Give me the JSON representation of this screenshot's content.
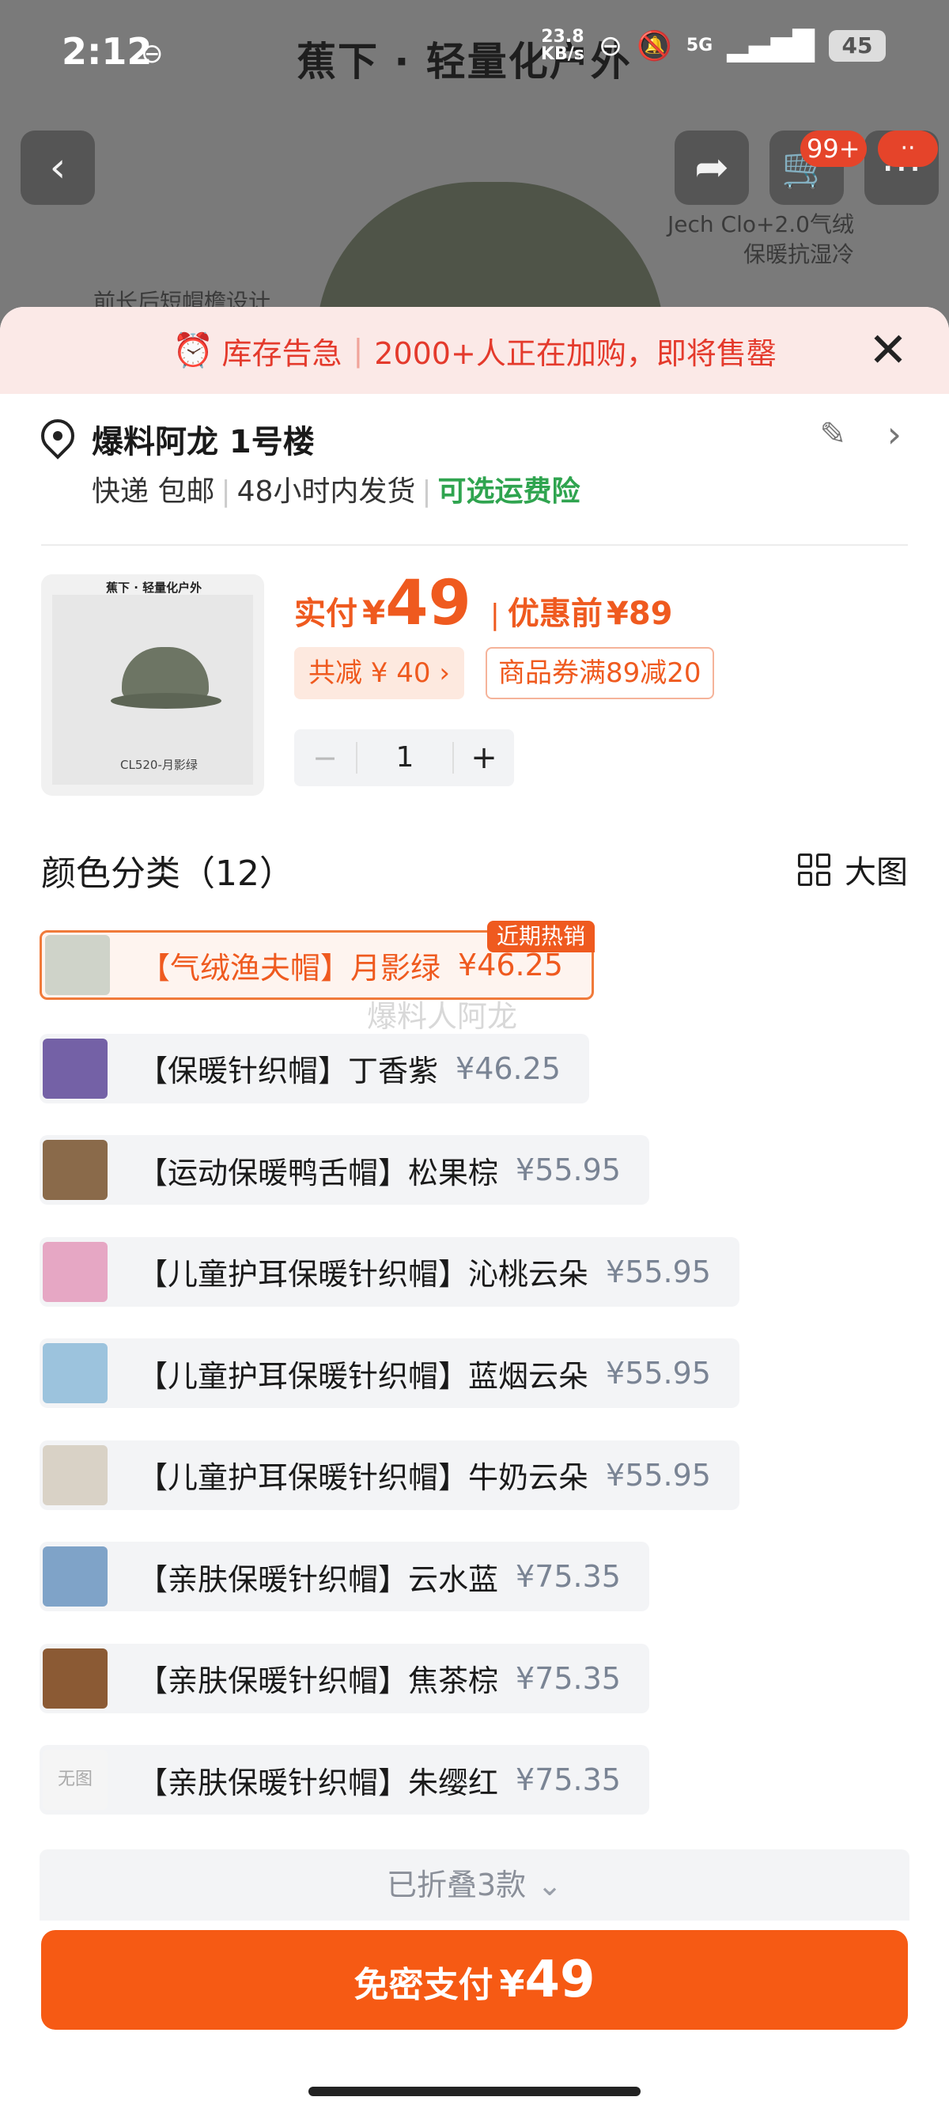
{
  "status_bar": {
    "time": "2:12",
    "net_speed_value": "23.8",
    "net_speed_unit": "KB/s",
    "signal": "5G",
    "battery": "45"
  },
  "background": {
    "brand": "蕉下 · 轻量化户外",
    "note_line1": "Jech Clo+2.0气绒",
    "note_line2": "保暖抗湿冷",
    "note_left": "前长后短帽檐设计"
  },
  "nav": {
    "cart_badge": "99+",
    "more_badge": "··"
  },
  "alert": {
    "text1": "库存告急",
    "text2": "2000+人正在加购，即将售罄"
  },
  "address": {
    "name": "爆料阿龙 1号楼",
    "shipping_method": "快递 包邮",
    "ship_time": "48小时内发货",
    "insurance": "可选运费险"
  },
  "product": {
    "thumb_brand": "蕉下 · 轻量化户外",
    "thumb_caption": "CL520-月影绿",
    "price_label": "实付",
    "currency": "¥",
    "price": "49",
    "before_label": "优惠前",
    "before_price": "¥89",
    "discount": "共减 ¥ 40 ›",
    "coupon": "商品券满89减20",
    "quantity": "1",
    "minus": "−",
    "plus": "+"
  },
  "category": {
    "title": "颜色分类（12）",
    "view_toggle": "大图",
    "hot_tag": "近期热销",
    "watermark": "爆料人阿龙",
    "variants": [
      {
        "name": "【气绒渔夫帽】月影绿",
        "price": "¥46.25",
        "selected": true
      },
      {
        "name": "【保暖针织帽】丁香紫",
        "price": "¥46.25"
      },
      {
        "name": "【运动保暖鸭舌帽】松果棕",
        "price": "¥55.95"
      },
      {
        "name": "【儿童护耳保暖针织帽】沁桃云朵",
        "price": "¥55.95"
      },
      {
        "name": "【儿童护耳保暖针织帽】蓝烟云朵",
        "price": "¥55.95"
      },
      {
        "name": "【儿童护耳保暖针织帽】牛奶云朵",
        "price": "¥55.95"
      },
      {
        "name": "【亲肤保暖针织帽】云水蓝",
        "price": "¥75.35"
      },
      {
        "name": "【亲肤保暖针织帽】焦茶棕",
        "price": "¥75.35"
      },
      {
        "name": "【亲肤保暖针织帽】朱缨红",
        "price": "¥75.35"
      }
    ],
    "no_image": "无图",
    "folded": "已折叠3款"
  },
  "pay": {
    "label": "免密支付",
    "currency": "¥",
    "amount": "49"
  },
  "colors": {
    "accent": "#ef5a1f",
    "alert_red": "#e43a2c",
    "green": "#2fa44f"
  }
}
